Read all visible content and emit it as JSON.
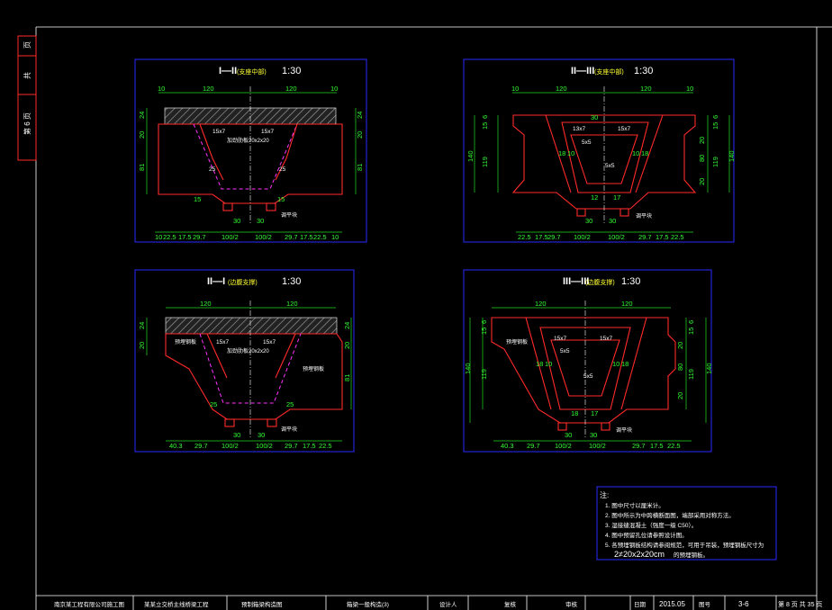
{
  "side_tab": {
    "labels": [
      "第 6 页",
      "共",
      "页"
    ]
  },
  "sections": [
    {
      "title": "I—II",
      "note": "(支座中部)",
      "scale": "1:30",
      "top_dims": [
        "10",
        "120",
        "120",
        "10"
      ],
      "bottom_dims": [
        "10",
        "22.5",
        "17.5",
        "29.7",
        "100/2",
        "100/2",
        "29.7",
        "17.5",
        "22.5",
        "10"
      ],
      "left_dims": [
        "24",
        "20",
        "81"
      ],
      "right_dims": [
        "24",
        "20",
        "81"
      ],
      "labels": [
        "15x7",
        "15x7",
        "加劲肋板20x2x20",
        "25",
        "25",
        "15",
        "15",
        "30",
        "30",
        "调平块"
      ]
    },
    {
      "title": "II—III",
      "note": "(支座中部)",
      "scale": "1:30",
      "top_dims": [
        "10",
        "120",
        "120",
        "10"
      ],
      "bottom_dims": [
        "22.5",
        "17.5",
        "29.7",
        "100/2",
        "100/2",
        "29.7",
        "17.5",
        "22.5"
      ],
      "left_dims": [
        "6",
        "15",
        "140",
        "119"
      ],
      "right_dims": [
        "6",
        "15",
        "140",
        "119",
        "20",
        "80",
        "20"
      ],
      "labels": [
        "13x7",
        "15x7",
        "30",
        "5x5",
        "5x5",
        "18",
        "10",
        "10",
        "18",
        "12",
        "17",
        "30",
        "30",
        "调平块"
      ]
    },
    {
      "title": "II—I",
      "note": "(边腹支撑)",
      "scale": "1:30",
      "top_dims": [
        "120",
        "120"
      ],
      "bottom_dims": [
        "40.3",
        "29.7",
        "100/2",
        "100/2",
        "29.7",
        "17.5",
        "22.5"
      ],
      "left_dims": [
        "24",
        "20"
      ],
      "right_dims": [
        "24",
        "20",
        "81"
      ],
      "labels": [
        "15x7",
        "15x7",
        "加劲肋板20x2x20",
        "25",
        "25",
        "30",
        "30",
        "调平块",
        "预埋钢板",
        "预埋钢板"
      ]
    },
    {
      "title": "III—III",
      "note": "(边腹支撑)",
      "scale": "1:30",
      "top_dims": [
        "120",
        "120"
      ],
      "bottom_dims": [
        "40.3",
        "29.7",
        "100/2",
        "100/2",
        "29.7",
        "17.5",
        "22.5"
      ],
      "left_dims": [
        "6",
        "15",
        "140",
        "119"
      ],
      "right_dims": [
        "6",
        "15",
        "140",
        "119",
        "20",
        "80",
        "20"
      ],
      "labels": [
        "15x7",
        "15x7",
        "5x5",
        "5x5",
        "18",
        "10",
        "10",
        "18",
        "18",
        "17",
        "30",
        "30",
        "预埋钢板",
        "调平块"
      ]
    }
  ],
  "notes": {
    "header": "注:",
    "items": [
      "1. 图中尺寸以厘米计。",
      "2. 图中所示为中跨横断面图，端部采用对称方法。",
      "3. 湿接缝混凝土（强度一级 C50）。",
      "4. 图中预留孔位请参照设计图。",
      "5. 各预埋钢板结构请参阅规范，可用于吊装，预埋钢板尺寸为",
      "2≠20x2x20cm"
    ],
    "last_item_suffix": "的预埋钢板。"
  },
  "title_block": {
    "cells": [
      "南京某工程有限公司施工图",
      "某某立交桥主线桥梁工程",
      "预制箱梁构造图",
      "箱梁一般构造(3)",
      "设计人",
      "复核",
      "审核",
      "日期",
      "2015.05",
      "图号",
      "3-6",
      "第 8 页 共 35 页"
    ]
  },
  "colors": {
    "background": "#000000",
    "frame": "#2a2aff",
    "outline": "#ff2a2a",
    "dimension": "#33ff33",
    "text": "#ffffff",
    "accent": "#ff33ff",
    "label": "#ffff33"
  }
}
